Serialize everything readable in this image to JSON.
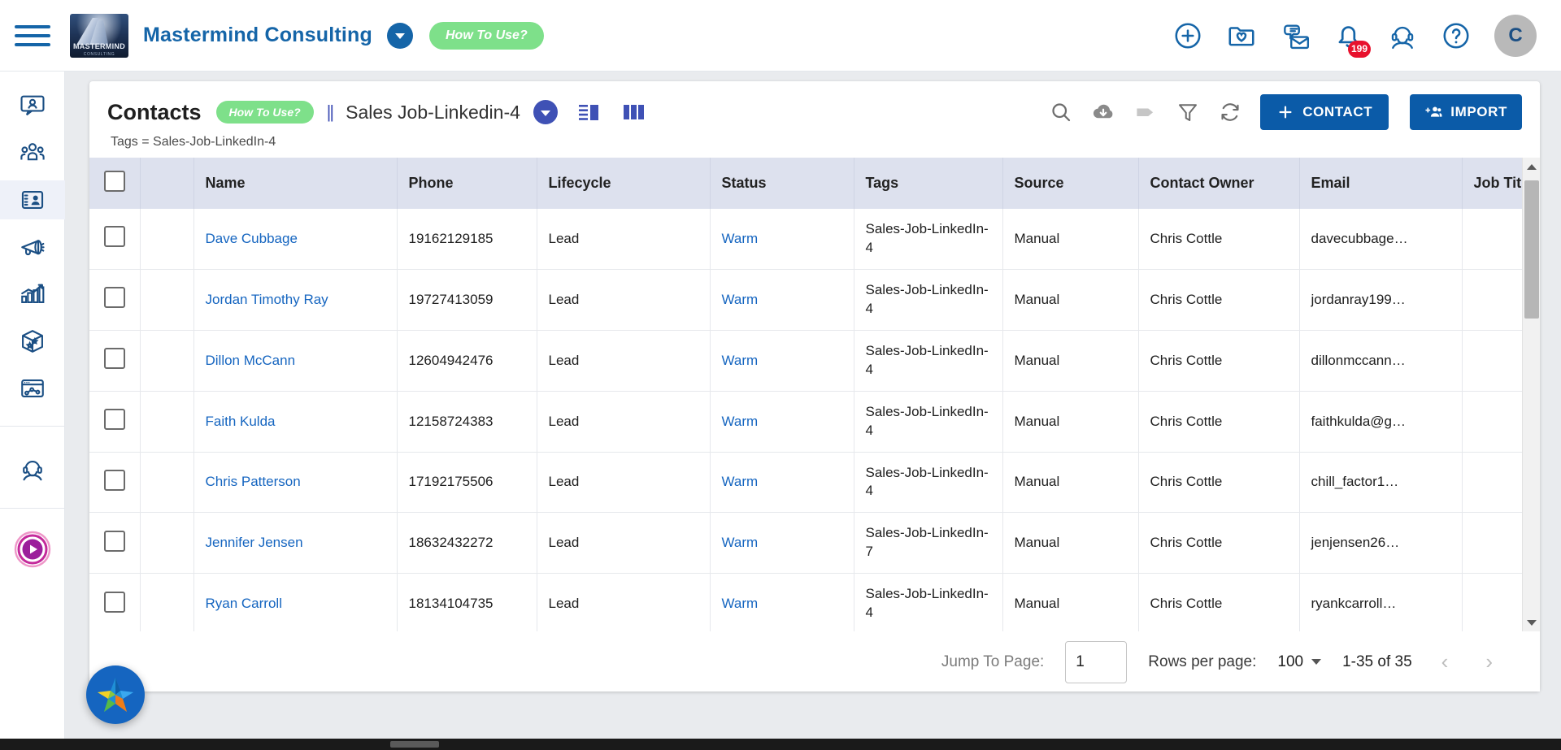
{
  "topbar": {
    "menu_icon": "hamburger-menu-icon",
    "logo_text": "MASTERMIND",
    "logo_subtext": "CONSULTING",
    "brand_name": "Mastermind Consulting",
    "brand_dropdown_icon": "chevron-down-icon",
    "how_to_use": "How To Use?",
    "icons": [
      {
        "name": "add-circle-icon",
        "label": "Add"
      },
      {
        "name": "folder-favorite-icon",
        "label": "Favorites"
      },
      {
        "name": "message-envelope-icon",
        "label": "Messages"
      },
      {
        "name": "notification-bell-icon",
        "label": "Notifications",
        "badge": "199"
      },
      {
        "name": "support-headset-icon",
        "label": "Support"
      },
      {
        "name": "help-circle-icon",
        "label": "Help"
      }
    ],
    "avatar_initial": "C"
  },
  "sidebar": {
    "items": [
      {
        "name": "sidebar-item-conversations",
        "icon": "chat-user-icon"
      },
      {
        "name": "sidebar-item-audience",
        "icon": "people-group-icon"
      },
      {
        "name": "sidebar-item-contacts",
        "icon": "contact-card-icon",
        "active": true
      },
      {
        "name": "sidebar-item-campaigns",
        "icon": "megaphone-icon"
      },
      {
        "name": "sidebar-item-reports",
        "icon": "bar-chart-growth-icon"
      },
      {
        "name": "sidebar-item-products",
        "icon": "package-star-icon"
      },
      {
        "name": "sidebar-item-analytics",
        "icon": "analytics-window-icon"
      },
      {
        "name": "sidebar-item-support",
        "icon": "support-headset-icon"
      },
      {
        "name": "sidebar-item-tutorials",
        "icon": "play-circle-icon"
      }
    ]
  },
  "page": {
    "title": "Contacts",
    "how_to_use": "How To Use?",
    "divider": "||",
    "segment_name": "Sales Job-Linkedin-4",
    "segment_dropdown_icon": "chevron-down-icon",
    "view_toggles": [
      {
        "name": "list-view-icon",
        "active": true
      },
      {
        "name": "kanban-view-icon",
        "active": false
      }
    ],
    "action_icons": [
      {
        "name": "search-icon"
      },
      {
        "name": "cloud-download-icon"
      },
      {
        "name": "tag-icon"
      },
      {
        "name": "filter-funnel-icon"
      },
      {
        "name": "refresh-icon"
      }
    ],
    "contact_button": "CONTACT",
    "contact_button_icon": "plus-icon",
    "import_button": "IMPORT",
    "import_button_icon": "person-add-icon",
    "filter_summary": "Tags = Sales-Job-LinkedIn-4"
  },
  "table": {
    "columns": [
      "Name",
      "Phone",
      "Lifecycle",
      "Status",
      "Tags",
      "Source",
      "Contact Owner",
      "Email",
      "Job Title"
    ],
    "rows": [
      {
        "name": "Dave Cubbage",
        "phone": "19162129185",
        "lifecycle": "Lead",
        "status": "Warm",
        "tags": "Sales-Job-LinkedIn-4",
        "source": "Manual",
        "owner": "Chris Cottle",
        "email": "davecubbage…",
        "job_title": ""
      },
      {
        "name": "Jordan Timothy Ray",
        "phone": "19727413059",
        "lifecycle": "Lead",
        "status": "Warm",
        "tags": "Sales-Job-LinkedIn-4",
        "source": "Manual",
        "owner": "Chris Cottle",
        "email": "jordanray199…",
        "job_title": ""
      },
      {
        "name": "Dillon McCann",
        "phone": "12604942476",
        "lifecycle": "Lead",
        "status": "Warm",
        "tags": "Sales-Job-LinkedIn-4",
        "source": "Manual",
        "owner": "Chris Cottle",
        "email": "dillonmccann…",
        "job_title": ""
      },
      {
        "name": "Faith Kulda",
        "phone": "12158724383",
        "lifecycle": "Lead",
        "status": "Warm",
        "tags": "Sales-Job-LinkedIn-4",
        "source": "Manual",
        "owner": "Chris Cottle",
        "email": "faithkulda@g…",
        "job_title": ""
      },
      {
        "name": "Chris Patterson",
        "phone": "17192175506",
        "lifecycle": "Lead",
        "status": "Warm",
        "tags": "Sales-Job-LinkedIn-4",
        "source": "Manual",
        "owner": "Chris Cottle",
        "email": "chill_factor1…",
        "job_title": ""
      },
      {
        "name": "Jennifer Jensen",
        "phone": "18632432272",
        "lifecycle": "Lead",
        "status": "Warm",
        "tags": "Sales-Job-LinkedIn-7",
        "source": "Manual",
        "owner": "Chris Cottle",
        "email": "jenjensen26…",
        "job_title": ""
      },
      {
        "name": "Ryan Carroll",
        "phone": "18134104735",
        "lifecycle": "Lead",
        "status": "Warm",
        "tags": "Sales-Job-LinkedIn-4",
        "source": "Manual",
        "owner": "Chris Cottle",
        "email": "ryankcarroll…",
        "job_title": ""
      }
    ]
  },
  "footer": {
    "jump_label": "Jump To Page:",
    "jump_value": "1",
    "rows_per_page_label": "Rows per page:",
    "rows_per_page_value": "100",
    "range_text": "1-35 of 35",
    "prev_icon": "chevron-left-icon",
    "next_icon": "chevron-right-icon"
  },
  "fab": {
    "name": "star-assistant-fab",
    "label": "Assistant"
  },
  "colors": {
    "brand_blue": "#1565a8",
    "primary_button": "#0b5ba8",
    "accent_green": "#7ee08a",
    "link_blue": "#1565c0",
    "badge_red": "#e8112d",
    "header_row": "#dde1ee"
  }
}
